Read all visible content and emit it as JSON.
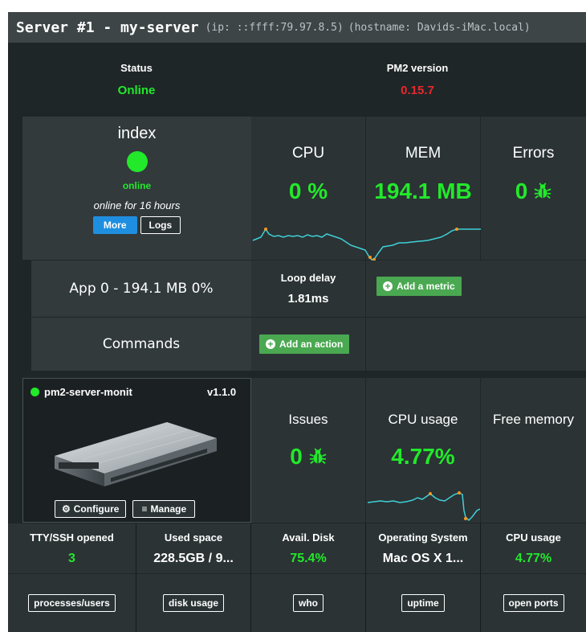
{
  "header": {
    "title": "Server #1 - my-server",
    "ip": "(ip: ::ffff:79.97.8.5)",
    "hostname": "(hostname: Davids-iMac.local)"
  },
  "status": {
    "label": "Status",
    "value": "Online"
  },
  "pm2": {
    "label": "PM2 version",
    "value": "0.15.7"
  },
  "process": {
    "name": "index",
    "state": "online",
    "uptime": "online for 16 hours",
    "more_label": "More",
    "logs_label": "Logs",
    "cpu_label": "CPU",
    "cpu_value": "0 %",
    "mem_label": "MEM",
    "mem_value": "194.1 MB",
    "errors_label": "Errors",
    "errors_value": "0",
    "app_summary": "App 0 - 194.1 MB 0%",
    "loop_delay_label": "Loop delay",
    "loop_delay_value": "1.81ms",
    "add_metric_label": "Add a metric",
    "commands_label": "Commands",
    "add_action_label": "Add an action"
  },
  "module": {
    "name": "pm2-server-monit",
    "version": "v1.1.0",
    "configure_label": "Configure",
    "manage_label": "Manage",
    "issues_label": "Issues",
    "issues_value": "0",
    "cpu_usage_label": "CPU usage",
    "cpu_usage_value": "4.77%",
    "free_memory_label": "Free memory"
  },
  "stats": [
    {
      "label": "TTY/SSH opened",
      "value": "3",
      "color": "#22e92a"
    },
    {
      "label": "Used space",
      "value": "228.5GB / 9...",
      "color": "#ffffff"
    },
    {
      "label": "Avail. Disk",
      "value": "75.4%",
      "color": "#22e92a"
    },
    {
      "label": "Operating System",
      "value": "Mac OS X 1...",
      "color": "#ffffff"
    },
    {
      "label": "CPU usage",
      "value": "4.77%",
      "color": "#22e92a"
    }
  ],
  "actions": [
    "processes/users",
    "disk usage",
    "who",
    "uptime",
    "open ports"
  ],
  "colors": {
    "accent_green": "#22e92a",
    "error_red": "#e8282b",
    "button_blue": "#1e8fe0",
    "button_green": "#4aa851",
    "sparkline": "#3fd0d6"
  },
  "icons": {
    "bug": "bug-icon",
    "gear": "gear-icon",
    "menu": "menu-icon",
    "plus": "plus-circle-icon",
    "status_dot": "status-dot-icon",
    "server": "server-rack-image"
  }
}
